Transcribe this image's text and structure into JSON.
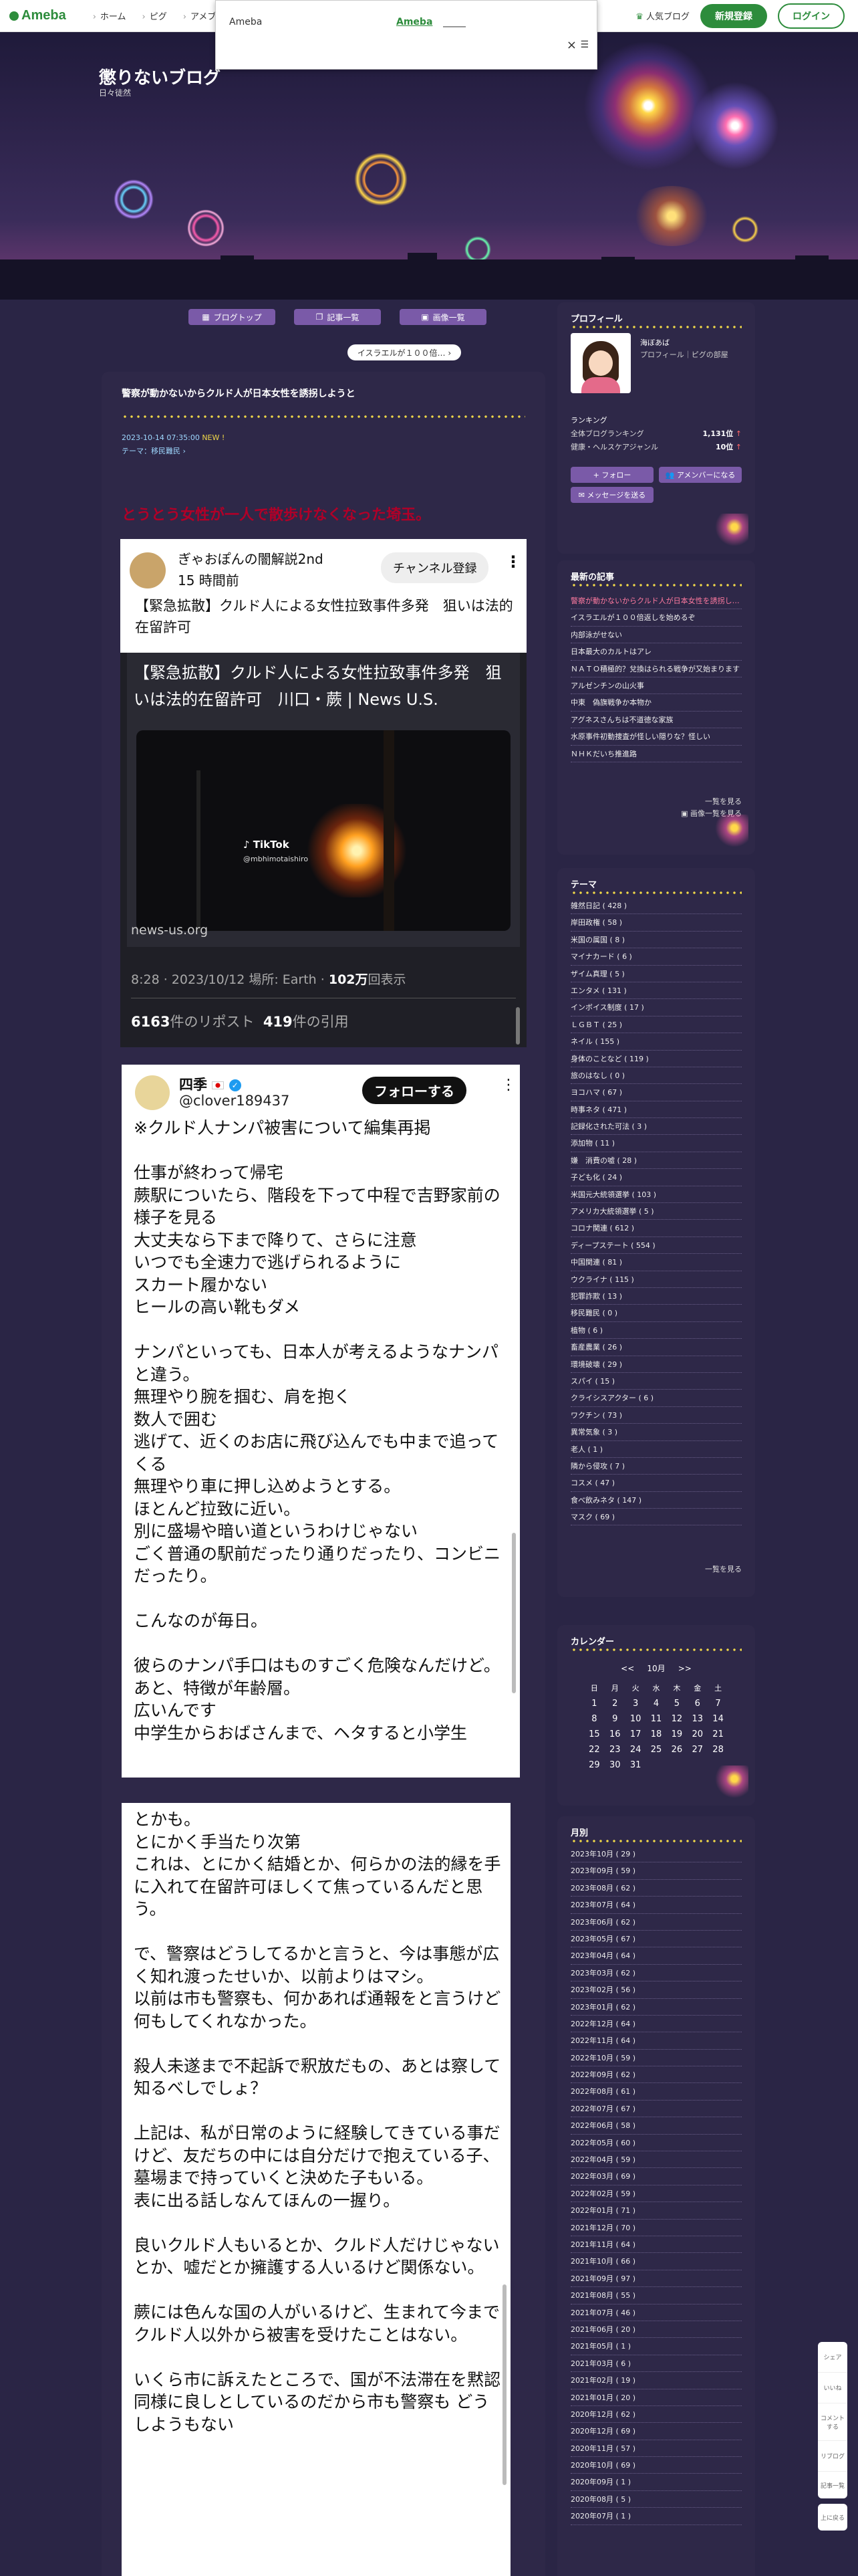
{
  "header": {
    "logo": "Ameba",
    "nav": [
      "ホーム",
      "ピグ",
      "アメブロ"
    ],
    "popular": "人気ブログ",
    "register": "新規登録",
    "login": "ログイン"
  },
  "ad_popup": {
    "label": "Ameba",
    "link": "Ameba"
  },
  "blog": {
    "title": "懲りないブログ",
    "subtitle": "日々徒然"
  },
  "blog_nav": {
    "top": "ブログトップ",
    "entries": "記事一覧",
    "images": "画像一覧",
    "next": "イスラエルが１００倍… ›"
  },
  "article": {
    "title": "警察が動かないからクルド人が日本女性を誘拐しようと",
    "date": "2023-10-14 07:35:00",
    "date_badge": "NEW !",
    "theme": "テーマ：移民難民 ›",
    "lead": "とうとう女性が一人で散歩けなくなった埼玉。"
  },
  "embed1": {
    "channel": "ぎゃおぽんの闇解説2nd",
    "time": "15 時間前",
    "subscribe": "チャンネル登録",
    "title": "【緊急拡散】クルド人による女性拉致事件多発　狙いは法的在留許可",
    "card_title": "【緊急拡散】クルド人による女性拉致事件多発　狙いは法的在留許可　川口・蕨 | News U.S.",
    "tiktok": "TikTok",
    "tiktok_user": "@mbhimotaishiro",
    "domain": "news-us.org",
    "meta_prefix": "8:28 · 2023/10/12 場所: Earth · ",
    "views": "102万",
    "views_suffix": "回表示",
    "reposts": "6163",
    "reposts_label": "件のリポスト",
    "quotes": "419",
    "quotes_label": "件の引用"
  },
  "embed2": {
    "name": "四季",
    "handle": "@clover189437",
    "follow": "フォローする",
    "text": "※クルド人ナンパ被害について編集再掲\n\n仕事が終わって帰宅\n蕨駅についたら、階段を下って中程で吉野家前の様子を見る\n大丈夫なら下まで降りて、さらに注意\nいつでも全速力で逃げられるように\nスカート履かない\nヒールの高い靴もダメ\n\nナンパといっても、日本人が考えるようなナンパと違う。\n無理やり腕を掴む、肩を抱く\n数人で囲む\n逃げて、近くのお店に飛び込んでも中まで追ってくる\n無理やり車に押し込めようとする。\nほとんど拉致に近い。\n別に盛場や暗い道というわけじゃない\nごく普通の駅前だったり通りだったり、コンビニだったり。\n\nこんなのが毎日。\n\n彼らのナンパ手口はものすごく危険なんだけど。\nあと、特徴が年齢層。\n広いんです\n中学生からおばさんまで、ヘタすると小学生"
  },
  "embed3": {
    "text": "とかも。\nとにかく手当たり次第\nこれは、とにかく結婚とか、何らかの法的縁を手に入れて在留許可ほしくて焦っているんだと思う。\n\nで、警察はどうしてるかと言うと、今は事態が広く知れ渡ったせいか、以前よりはマシ。\n以前は市も警察も、何かあれば通報をと言うけど何もしてくれなかった。\n\n殺人未遂まで不起訴で釈放だもの、あとは察して知るべしでしょ？\n\n上記は、私が日常のように経験してきている事だけど、友だちの中には自分だけで抱えている子、墓場まで持っていくと決めた子もいる。\n表に出る話しなんてほんの一握り。\n\n良いクルド人もいるとか、クルド人だけじゃないとか、嘘だとか擁護する人いるけど関係ない。\n\n蕨には色んな国の人がいるけど、生まれて今までクルド人以外から被害を受けたことはない。\n\nいくら市に訴えたところで、国が不法滞在を黙認同様に良しとしているのだから市も警察も どうしようもない"
  },
  "profile": {
    "heading": "プロフィール",
    "name": "海ぼあば",
    "desc": "プロフィール｜ピグの部屋",
    "ranking_heading": "ランキング",
    "rank1_label": "全体ブログランキング",
    "rank1_value": "1,131位",
    "rank2_label": "健康・ヘルスケアジャンル",
    "rank2_value": "10位",
    "follow": "+ フォロー",
    "member": "アメンバーになる",
    "message": "メッセージを送る"
  },
  "recent": {
    "heading": "最新の記事",
    "items": [
      "警察が動かないからクルド人が日本女性を誘拐しようと",
      "イスラエルが１００倍返しを始めるぞ",
      "内部泳がせない",
      "日本最大のカルトはアレ",
      "ＮＡＴＯ積極的？兌換はられる戦争が又始まります",
      "アルゼンチンの山火事",
      "中東　偽旗戦争か本物か",
      "アグネスさんちは不道徳な家族",
      "水原事件初動捜査が怪しい隠りな？怪しい",
      "ＮＨＫだいち推進路"
    ],
    "more": "一覧を見る",
    "images_more": "画像一覧を見る"
  },
  "themes": {
    "heading": "テーマ",
    "items": [
      "雑然日記 ( 428 )",
      "岸田政権 ( 58 )",
      "米国の属国 ( 8 )",
      "マイナカード ( 6 )",
      "ザイム真理 ( 5 )",
      "エンタメ ( 131 )",
      "インボイス制度 ( 17 )",
      "ＬＧＢＴ ( 25 )",
      "ネイル ( 155 )",
      "身体のことなど ( 119 )",
      "旅のはなし ( 0 )",
      "ヨコハマ ( 67 )",
      "時事ネタ ( 471 )",
      "記録化された可法 ( 3 )",
      "添加物 ( 11 )",
      "嫌　消費の嘘 ( 28 )",
      "子ども化 ( 24 )",
      "米国元大統領選挙 ( 103 )",
      "アメリカ大統領選挙 ( 5 )",
      "コロナ関連 ( 612 )",
      "ディープステート ( 554 )",
      "中国関連 ( 81 )",
      "ウクライナ ( 115 )",
      "犯罪詐欺 ( 13 )",
      "移民難民 ( 0 )",
      "植物 ( 6 )",
      "畜産農業 ( 26 )",
      "環境破壊 ( 29 )",
      "スパイ ( 15 )",
      "クライシスアクター ( 6 )",
      "ワクチン ( 73 )",
      "異常気象 ( 3 )",
      "老人 ( 1 )",
      "隣から侵攻 ( 7 )",
      "コスメ ( 47 )",
      "食べ飲みネタ ( 147 )",
      "マスク ( 69 )"
    ],
    "more": "一覧を見る"
  },
  "calendar": {
    "heading": "カレンダー",
    "month": "10月",
    "prev": "<<",
    "next": ">>",
    "weekdays": [
      "日",
      "月",
      "火",
      "水",
      "木",
      "金",
      "土"
    ],
    "days": [
      "1",
      "2",
      "3",
      "4",
      "5",
      "6",
      "7",
      "8",
      "9",
      "10",
      "11",
      "12",
      "13",
      "14",
      "15",
      "16",
      "17",
      "18",
      "19",
      "20",
      "21",
      "22",
      "23",
      "24",
      "25",
      "26",
      "27",
      "28",
      "29",
      "30",
      "31"
    ]
  },
  "archive": {
    "heading": "月別",
    "items": [
      "2023年10月 ( 29 )",
      "2023年09月 ( 59 )",
      "2023年08月 ( 62 )",
      "2023年07月 ( 64 )",
      "2023年06月 ( 62 )",
      "2023年05月 ( 67 )",
      "2023年04月 ( 64 )",
      "2023年03月 ( 62 )",
      "2023年02月 ( 56 )",
      "2023年01月 ( 62 )",
      "2022年12月 ( 64 )",
      "2022年11月 ( 64 )",
      "2022年10月 ( 59 )",
      "2022年09月 ( 62 )",
      "2022年08月 ( 61 )",
      "2022年07月 ( 67 )",
      "2022年06月 ( 58 )",
      "2022年05月 ( 60 )",
      "2022年04月 ( 59 )",
      "2022年03月 ( 69 )",
      "2022年02月 ( 59 )",
      "2022年01月 ( 71 )",
      "2021年12月 ( 70 )",
      "2021年11月 ( 64 )",
      "2021年10月 ( 66 )",
      "2021年09月 ( 97 )",
      "2021年08月 ( 55 )",
      "2021年07月 ( 46 )",
      "2021年06月 ( 20 )",
      "2021年05月 ( 1 )",
      "2021年03月 ( 6 )",
      "2021年02月 ( 19 )",
      "2021年01月 ( 20 )",
      "2020年12月 ( 62 )",
      "2020年12月 ( 69 )",
      "2020年11月 ( 57 )",
      "2020年10月 ( 69 )",
      "2020年09月 ( 1 )",
      "2020年08月 ( 5 )",
      "2020年07月 ( 1 )"
    ]
  },
  "floatbar": {
    "share": "シェア",
    "like": "いいね",
    "comment": "コメントする",
    "reblog": "リブログ",
    "entries": "記事一覧",
    "top": "上に戻る"
  }
}
